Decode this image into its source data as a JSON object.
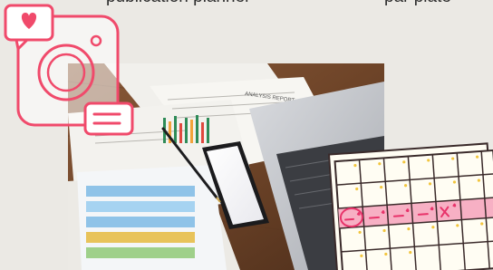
{
  "heading": {
    "left_fragment": "publication planner",
    "right_fragment": "par plate"
  },
  "colors": {
    "accent_pink": "#f04a6b",
    "calendar_stroke": "#3a2a2a",
    "calendar_fill": "#fffdf3",
    "calendar_highlight": "#f7b0c4",
    "calendar_dots": "#f2c53d",
    "background": "#ebe9e4"
  },
  "icons": [
    "heart-icon",
    "camera-icon",
    "menu-icon",
    "pen-icon",
    "smartphone-icon",
    "laptop-icon",
    "calendar-icon"
  ],
  "photo_caption": "ANALYSIS REPORT"
}
